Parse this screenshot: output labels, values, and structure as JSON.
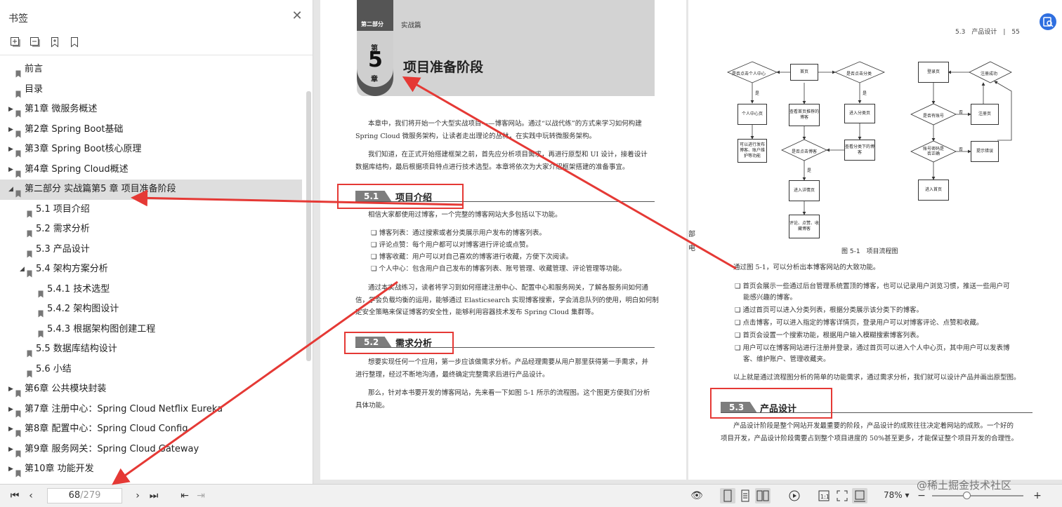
{
  "sidebar": {
    "title": "书签",
    "close_icon": "close-icon",
    "tools": [
      "expand-all-icon",
      "collapse-all-icon",
      "add-bookmark-icon",
      "bookmark-icon"
    ],
    "items": [
      {
        "label": "前言",
        "level": 0,
        "has_children": false,
        "expanded": false,
        "selected": false
      },
      {
        "label": "目录",
        "level": 0,
        "has_children": false,
        "expanded": false,
        "selected": false
      },
      {
        "label": "第1章 微服务概述",
        "level": 0,
        "has_children": true,
        "expanded": false,
        "selected": false
      },
      {
        "label": "第2章 Spring Boot基础",
        "level": 0,
        "has_children": true,
        "expanded": false,
        "selected": false
      },
      {
        "label": "第3章 Spring Boot核心原理",
        "level": 0,
        "has_children": true,
        "expanded": false,
        "selected": false
      },
      {
        "label": "第4章 Spring Cloud概述",
        "level": 0,
        "has_children": true,
        "expanded": false,
        "selected": false
      },
      {
        "label": "第二部分 实战篇第5 章 项目准备阶段",
        "level": 0,
        "has_children": true,
        "expanded": true,
        "selected": true
      },
      {
        "label": "5.1 项目介绍",
        "level": 1,
        "has_children": false,
        "expanded": false,
        "selected": false
      },
      {
        "label": "5.2 需求分析",
        "level": 1,
        "has_children": false,
        "expanded": false,
        "selected": false
      },
      {
        "label": "5.3 产品设计",
        "level": 1,
        "has_children": false,
        "expanded": false,
        "selected": false
      },
      {
        "label": "5.4 架构方案分析",
        "level": 1,
        "has_children": true,
        "expanded": true,
        "selected": false
      },
      {
        "label": "5.4.1 技术选型",
        "level": 2,
        "has_children": false,
        "expanded": false,
        "selected": false
      },
      {
        "label": "5.4.2 架构图设计",
        "level": 2,
        "has_children": false,
        "expanded": false,
        "selected": false
      },
      {
        "label": "5.4.3 根据架构图创建工程",
        "level": 2,
        "has_children": false,
        "expanded": false,
        "selected": false
      },
      {
        "label": "5.5 数据库结构设计",
        "level": 1,
        "has_children": false,
        "expanded": false,
        "selected": false
      },
      {
        "label": "5.6 小结",
        "level": 1,
        "has_children": false,
        "expanded": false,
        "selected": false
      },
      {
        "label": "第6章 公共模块封装",
        "level": 0,
        "has_children": true,
        "expanded": false,
        "selected": false
      },
      {
        "label": "第7章 注册中心：Spring Cloud Netflix Eureka",
        "level": 0,
        "has_children": true,
        "expanded": false,
        "selected": false
      },
      {
        "label": "第8章 配置中心：Spring Cloud Config",
        "level": 0,
        "has_children": true,
        "expanded": false,
        "selected": false
      },
      {
        "label": "第9章 服务网关：Spring Cloud Gateway",
        "level": 0,
        "has_children": true,
        "expanded": false,
        "selected": false
      },
      {
        "label": "第10章 功能开发",
        "level": 0,
        "has_children": true,
        "expanded": false,
        "selected": false
      }
    ]
  },
  "toolbar": {
    "page_current": "68",
    "page_total": "/279",
    "zoom": "78%",
    "zoom_level": 0.38,
    "icons": [
      "first-page-icon",
      "prev-page-icon",
      "next-page-icon",
      "last-page-icon",
      "back-icon",
      "forward-icon",
      "eye-icon",
      "single-page-icon",
      "continuous-page-icon",
      "two-page-icon",
      "play-icon",
      "actual-size-icon",
      "fit-page-icon",
      "fit-width-icon",
      "zoom-out-icon",
      "zoom-in-icon"
    ]
  },
  "watermark": "@稀土掘金技术社区",
  "left_page": {
    "part_label": "第二部分",
    "part_name": "实战篇",
    "chapter_top": "第",
    "chapter_num": "5",
    "chapter_bottom": "章",
    "chapter_title": "项目准备阶段",
    "intro_p1a": "本章中，我们将开始一个大型实战项目——博客网站。通过“以战代练”的方式来学习如何构建",
    "intro_p1b": "Spring Cloud 微服务架构，让读者走出理论的丛林，在实践中玩转微服务架构。",
    "intro_p2a": "我们知道，在正式开始搭建框架之前，首先应分析项目需求，再进行原型和 UI 设计，接着设计",
    "intro_p2b": "数据库结构，最后根据项目特点进行技术选型。本章将依次为大家介绍框架搭建的准备事宜。",
    "s1_num": "5.1",
    "s1_title": "项目介绍",
    "s1_p": "相信大家都使用过博客，一个完整的博客网站大多包括以下功能。",
    "s1_bullets": [
      "博客列表：通过搜索或者分类展示用户发布的博客列表。",
      "评论点赞：每个用户都可以对博客进行评论或点赞。",
      "博客收藏：用户可以对自己喜欢的博客进行收藏，方便下次阅读。",
      "个人中心：包含用户自己发布的博客列表、账号管理、收藏管理、评论管理等功能。"
    ],
    "s1_p2a": "通过本实战练习，读者将学习到如何搭建注册中心、配置中心和服务网关，了解各服务间如何通",
    "s1_p2b": "信，学会负载均衡的运用，能够通过 Elasticsearch 实现博客搜索，学会消息队列的使用，明白如何制",
    "s1_p2c": "定安全策略来保证博客的安全性，能够利用容器技术发布 Spring Cloud 集群等。",
    "s2_num": "5.2",
    "s2_title": "需求分析",
    "s2_p1a": "想要实现任何一个应用，第一步应该做需求分析。产品经理需要从用户那里获得第一手需求，并",
    "s2_p1b": "进行整理，经过不断地沟通，最终确定完整需求后进行产品设计。",
    "s2_p2a": "那么，针对本书要开发的博客网站，先来看一下如图 5-1 所示的流程图。这个图更方便我们分析",
    "s2_p2b": "具体功能。"
  },
  "right_page": {
    "header": "5.3　产品设计　|　55",
    "side_mark_1": "部",
    "side_mark_2": "电",
    "figure_caption": "图 5-1　项目流程图",
    "flow": {
      "home": "首页",
      "click_personal": "是否点击个人中心",
      "click_category": "是否点击分类",
      "personal_center": "个人中心页",
      "personal_detail": "可以进行发布博客、账户维护等功能",
      "recommended": "查看首页推荐的博客",
      "enter_category": "进入分类页",
      "category_blogs": "查看分类下的博客",
      "click_blog": "是否点击博客",
      "detail_page": "进入详情页",
      "comment": "评论、点赞、收藏博客",
      "login": "登录页",
      "login_ok": "注册成功",
      "has_account": "是否有账号",
      "register": "注册页",
      "pwd_check": "账号密码是否正确",
      "error_tip": "提示错误",
      "enter_home": "进入首页",
      "yes": "是",
      "no": "否"
    },
    "p1": "通过图 5-1，可以分析出本博客网站的大致功能。",
    "bullets": [
      "首页会展示一些通过后台管理系统置顶的博客，也可以记录用户浏览习惯，推送一些用户可",
      "能感兴趣的博客。",
      "通过首页可以进入分类列表，根据分类展示该分类下的博客。",
      "点击博客，可以进入指定的博客详情页，登录用户可以对博客评论、点赞和收藏。",
      "首页会设置一个搜索功能，根据用户输入模糊搜索博客列表。",
      "用户可以在博客网站进行注册并登录，通过首页可以进入个人中心页，其中用户可以发表博",
      "客、维护账户、管理收藏夹。"
    ],
    "p2": "以上就是通过流程图分析的简单的功能需求，通过需求分析，我们就可以设计产品并画出原型图。",
    "s3_num": "5.3",
    "s3_title": "产品设计",
    "s3_pa": "产品设计阶段是整个网站开发最重要的阶段，产品设计的成败往往决定着网站的成败。一个好的",
    "s3_pb": "项目开发，产品设计阶段需要占到整个项目进度的 50%甚至更多，才能保证整个项目开发的合理性。"
  },
  "colors": {
    "annotation_red": "#e53935",
    "selection": "#dedede",
    "chapter_band": "#d3d3d3"
  }
}
